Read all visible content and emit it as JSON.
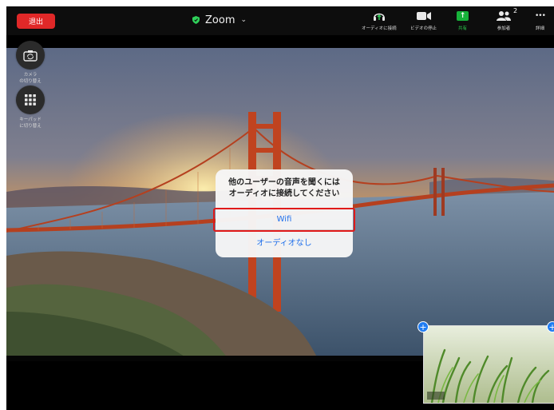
{
  "topbar": {
    "leave_label": "退出",
    "title": "Zoom",
    "audio_label": "オーディオに接続",
    "video_label": "ビデオの停止",
    "share_label": "共有",
    "participants_label": "参加者",
    "participants_count": "2",
    "more_label": "詳細",
    "more_glyph": "•••"
  },
  "side": {
    "camera_label_1": "カメラ",
    "camera_label_2": "の切り替え",
    "keypad_label_1": "キーパッド",
    "keypad_label_2": "に切り替え"
  },
  "dialog": {
    "message_line_1": "他のユーザーの音声を聞くには",
    "message_line_2": "オーディオに接続してください",
    "wifi_option": "Wifi",
    "no_audio_option": "オーディオなし"
  },
  "thumbnail": {
    "pin_symbol": "+"
  },
  "colors": {
    "leave_red": "#e02828",
    "share_green": "#17b33a",
    "link_blue": "#1f6feb",
    "highlight_red": "#e01a1a"
  }
}
